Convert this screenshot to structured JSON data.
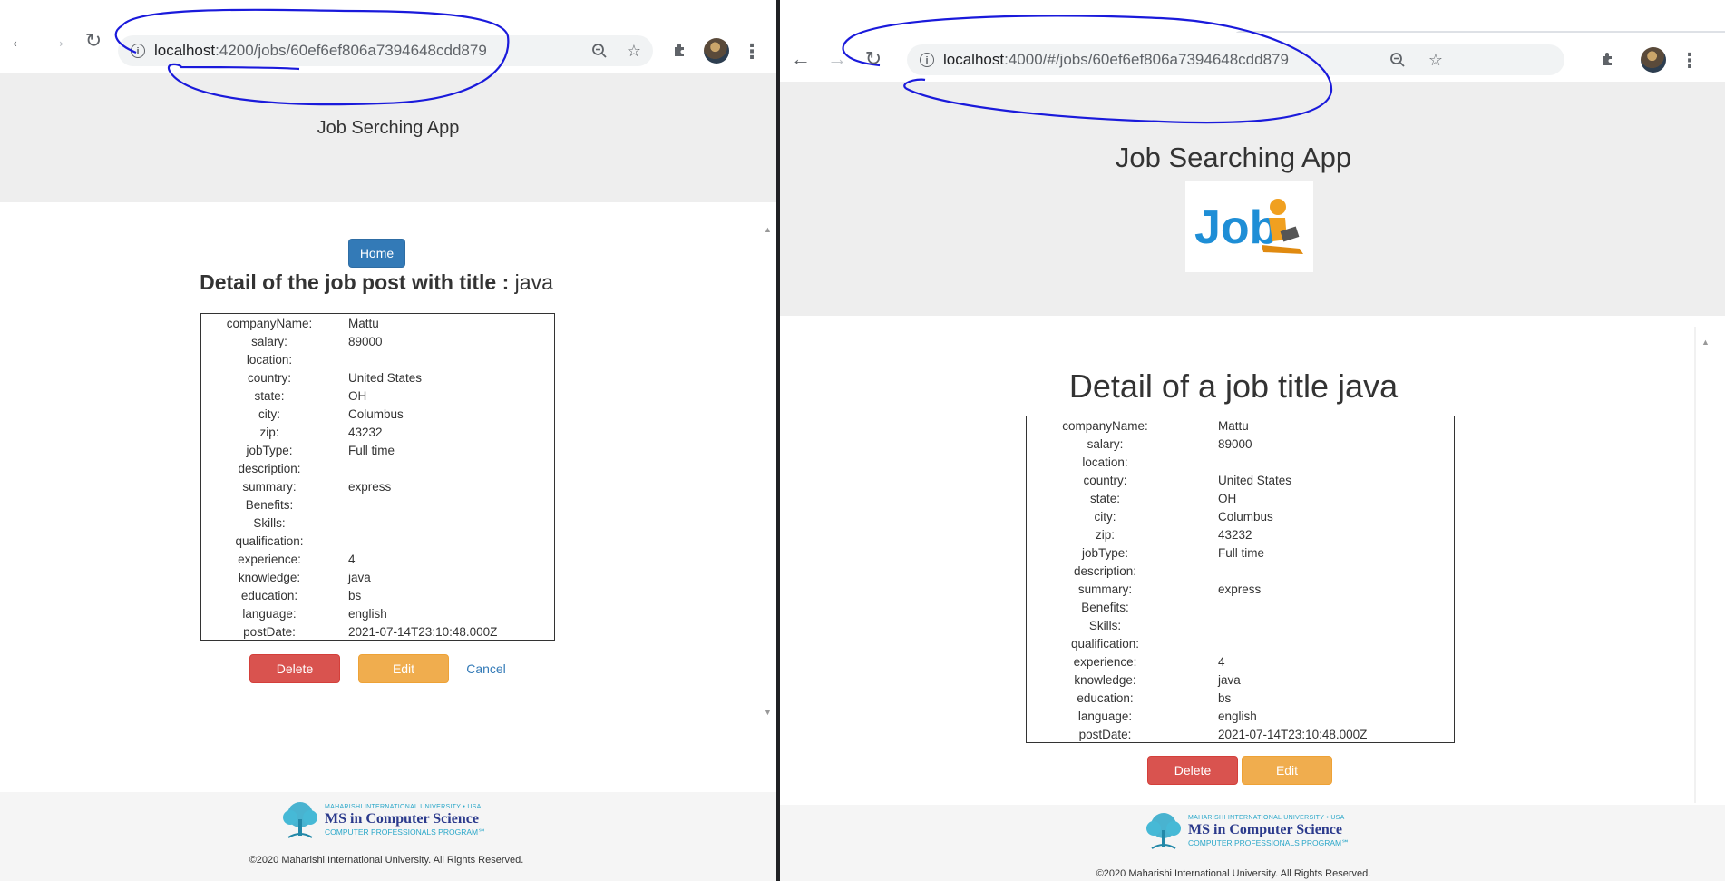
{
  "left": {
    "url_host": "localhost",
    "url_rest": ":4200/jobs/60ef6ef806a7394648cdd879",
    "app_title": "Job Serching App",
    "home_label": "Home",
    "heading_bold": "Detail of the job post with title :",
    "heading_title": "java",
    "delete_label": "Delete",
    "edit_label": "Edit",
    "cancel_label": "Cancel"
  },
  "right": {
    "url_host": "localhost",
    "url_rest": ":4000/#/jobs/60ef6ef806a7394648cdd879",
    "app_title": "Job Searching App",
    "heading": "Detail of a job title java",
    "delete_label": "Delete",
    "edit_label": "Edit"
  },
  "details": [
    {
      "key": "companyName:",
      "value": "Mattu"
    },
    {
      "key": "salary:",
      "value": "89000"
    },
    {
      "key": "location:",
      "value": ""
    },
    {
      "key": "country:",
      "value": "United States"
    },
    {
      "key": "state:",
      "value": "OH"
    },
    {
      "key": "city:",
      "value": "Columbus"
    },
    {
      "key": "zip:",
      "value": "43232"
    },
    {
      "key": "jobType:",
      "value": "Full time"
    },
    {
      "key": "description:",
      "value": ""
    },
    {
      "key": "summary:",
      "value": "express"
    },
    {
      "key": "Benefits:",
      "value": ""
    },
    {
      "key": "Skills:",
      "value": ""
    },
    {
      "key": "qualification:",
      "value": ""
    },
    {
      "key": "experience:",
      "value": "4"
    },
    {
      "key": "knowledge:",
      "value": "java"
    },
    {
      "key": "education:",
      "value": "bs"
    },
    {
      "key": "language:",
      "value": "english"
    },
    {
      "key": "postDate:",
      "value": "2021-07-14T23:10:48.000Z"
    }
  ],
  "footer": {
    "university": "MAHARISHI INTERNATIONAL UNIVERSITY • USA",
    "program": "MS in Computer Science",
    "subprogram": "COMPUTER PROFESSIONALS PROGRAM℠",
    "copyright": "©2020 Maharishi International University. All Rights Reserved."
  },
  "colors": {
    "primary": "#337ab7",
    "danger": "#d9534f",
    "warning": "#f0ad4e",
    "annotation": "#1a1adb"
  },
  "icons": [
    "back-arrow-icon",
    "forward-arrow-icon",
    "reload-icon",
    "info-icon",
    "zoom-out-icon",
    "star-icon",
    "extensions-icon",
    "profile-avatar",
    "more-menu-icon",
    "job-logo-image",
    "tree-logo-icon"
  ]
}
